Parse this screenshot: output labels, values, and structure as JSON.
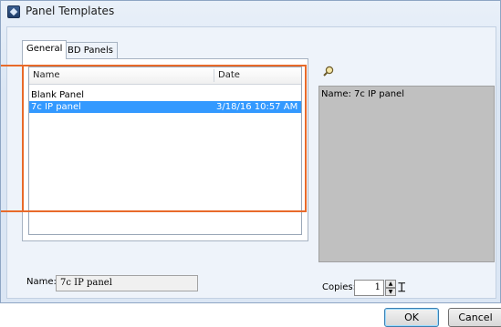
{
  "window": {
    "title": "Panel Templates"
  },
  "tabs": [
    {
      "label": "General",
      "active": true
    },
    {
      "label": "BD Panels",
      "active": false
    }
  ],
  "list": {
    "columns": [
      "Name",
      "Date"
    ],
    "rows": [
      {
        "name": "Blank Panel",
        "date": "",
        "selected": false
      },
      {
        "name": "7c IP panel",
        "date": "3/18/16 10:57 AM",
        "selected": true
      }
    ]
  },
  "preview": {
    "icon": "magnifier-icon",
    "text": "Name: 7c IP panel"
  },
  "name_field": {
    "label": "Name:",
    "value": "7c IP panel"
  },
  "copies": {
    "label": "Copies:",
    "value": "1"
  },
  "buttons": {
    "ok": "OK",
    "cancel": "Cancel"
  },
  "colors": {
    "selection": "#3399ff",
    "highlight": "#e86a2a",
    "preview_bg": "#c0c0c0"
  }
}
